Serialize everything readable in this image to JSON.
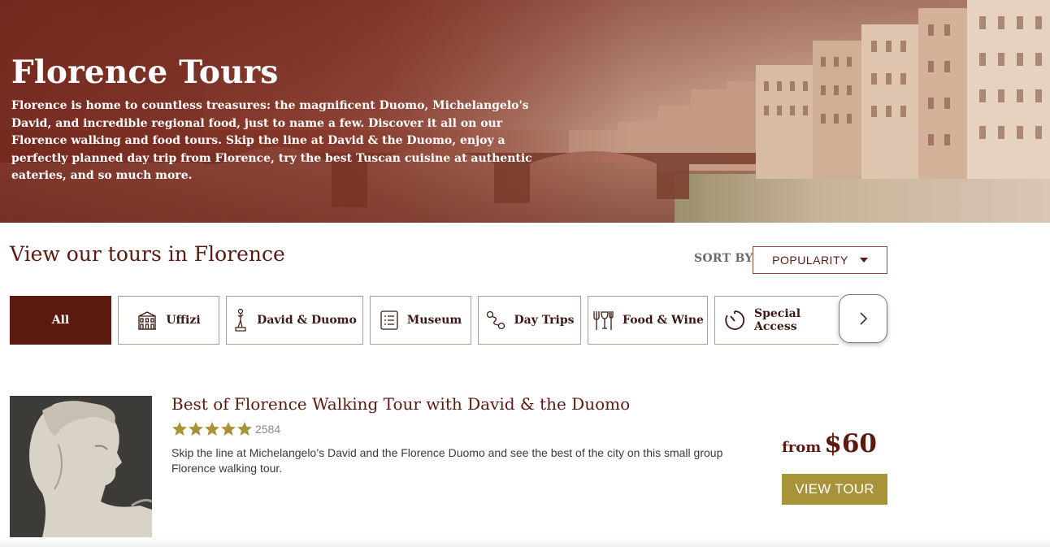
{
  "hero": {
    "title": "Florence Tours",
    "description": "Florence is home to countless treasures: the magnificent Duomo, Michelangelo's David, and incredible regional food, just to name a few. Discover it all on our Florence walking and food tours. Skip the line at David & the Duomo, enjoy a perfectly planned day trip from Florence, try the best Tuscan cuisine at authentic eateries, and so much more."
  },
  "section": {
    "title": "View our tours in Florence"
  },
  "sort": {
    "label": "SORT BY:",
    "selected": "POPULARITY"
  },
  "filters": [
    {
      "label": "All",
      "icon": "",
      "active": true
    },
    {
      "label": "Uffizi",
      "icon": "building-icon",
      "active": false
    },
    {
      "label": "David & Duomo",
      "icon": "statue-icon",
      "active": false
    },
    {
      "label": "Museum",
      "icon": "document-icon",
      "active": false
    },
    {
      "label": "Day Trips",
      "icon": "route-icon",
      "active": false
    },
    {
      "label": "Food & Wine",
      "icon": "dining-icon",
      "active": false
    },
    {
      "label": "Special Access",
      "icon": "timer-icon",
      "active": false
    }
  ],
  "tour": {
    "title": "Best of Florence Walking Tour with David & the Duomo",
    "rating_stars": 5,
    "review_count": "2584",
    "description": "Skip the line at Michelangelo’s David and the Florence Duomo and see the best of the city on this small group Florence walking tour.",
    "price_prefix": "from",
    "price": "$60",
    "button_label": "VIEW TOUR"
  },
  "colors": {
    "brand": "#5a1a10",
    "accent_button": "#a99338",
    "star": "#a99338"
  }
}
